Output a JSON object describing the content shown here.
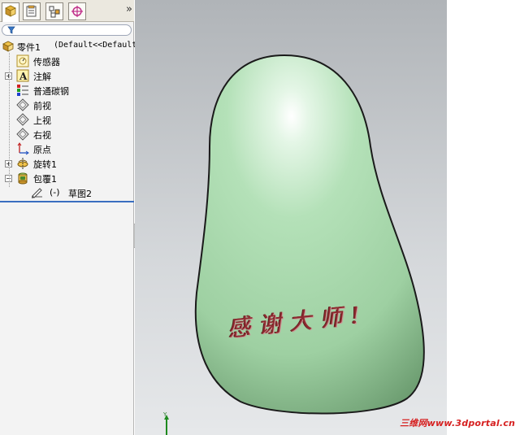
{
  "tree": {
    "root": {
      "label": "零件1",
      "config": "(Default<<Default"
    },
    "items": [
      {
        "label": "传感器",
        "icon": "sensor-icon",
        "expandable": false
      },
      {
        "label": "注解",
        "icon": "annotation-icon",
        "expandable": true
      },
      {
        "label": "普通碳钢",
        "icon": "material-icon",
        "expandable": false
      },
      {
        "label": "前视",
        "icon": "plane-icon",
        "expandable": false
      },
      {
        "label": "上视",
        "icon": "plane-icon",
        "expandable": false
      },
      {
        "label": "右视",
        "icon": "plane-icon",
        "expandable": false
      },
      {
        "label": "原点",
        "icon": "origin-icon",
        "expandable": false
      },
      {
        "label": "旋转1",
        "icon": "revolve-icon",
        "expandable": true
      },
      {
        "label": "包覆1",
        "icon": "wrap-icon",
        "expandable": true,
        "expanded": true
      }
    ],
    "child": {
      "prefix": "(-)",
      "label": "草图2",
      "icon": "sketch-icon"
    }
  },
  "panel": {
    "chevron": "»"
  },
  "viewport": {
    "engraved_text": "感谢大师!",
    "axis_label": "Y",
    "model_color": "#a6d6ab"
  },
  "watermark": "三维网www.3dportal.cn"
}
